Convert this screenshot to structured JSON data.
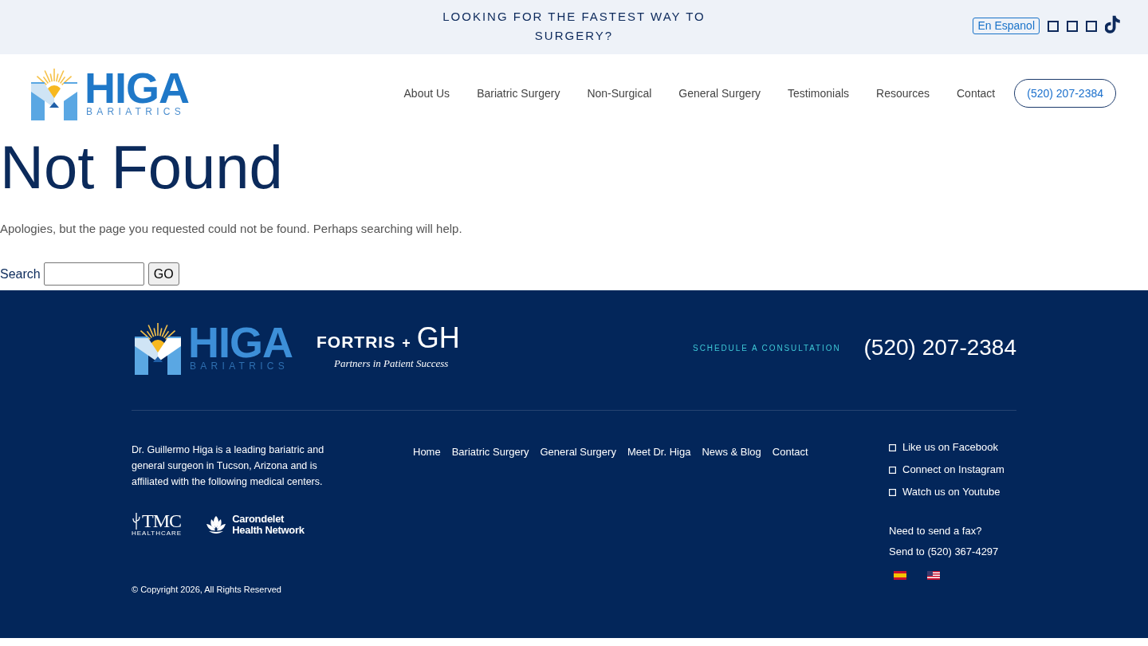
{
  "top_bar": {
    "message": "LOOKING FOR THE FASTEST WAY TO SURGERY?",
    "language_button": "En Espanol"
  },
  "header": {
    "logo": {
      "name": "HIGA",
      "tagline": "BARIATRICS"
    },
    "nav": [
      "About Us",
      "Bariatric Surgery",
      "Non-Surgical",
      "General Surgery",
      "Testimonials",
      "Resources",
      "Contact"
    ],
    "phone_button": "(520) 207-2384"
  },
  "content": {
    "title": "Not Found",
    "message": "Apologies, but the page you requested could not be found. Perhaps searching will help.",
    "search": {
      "label": "Search",
      "button": "GO"
    }
  },
  "footer": {
    "logo": {
      "name": "HIGA",
      "tagline": "BARIATRICS"
    },
    "partner_logo": {
      "brand": "FORTRIS",
      "plus": "+",
      "partner": "GH",
      "slogan": "Partners in Patient Success"
    },
    "cta": "SCHEDULE A CONSULTATION",
    "phone": "(520) 207-2384",
    "about": "Dr. Guillermo Higa is a leading bariatric and general surgeon in Tucson, Arizona and is affiliated with the following medical centers.",
    "affiliates": [
      {
        "kind": "tmc",
        "lines": [
          "TMC",
          "HEALTHCARE"
        ]
      },
      {
        "kind": "carondelet",
        "lines": [
          "Carondelet",
          "Health Network"
        ]
      }
    ],
    "copyright": "© Copyright 2026, All Rights Reserved",
    "links": [
      "Home",
      "Bariatric Surgery",
      "General Surgery",
      "Meet Dr. Higa",
      "News & Blog",
      "Contact"
    ],
    "social": [
      "Like us on Facebook",
      "Connect on Instagram",
      "Watch us on Youtube"
    ],
    "fax": [
      "Need to send a fax?",
      "Send to (520) 367-4297"
    ]
  }
}
